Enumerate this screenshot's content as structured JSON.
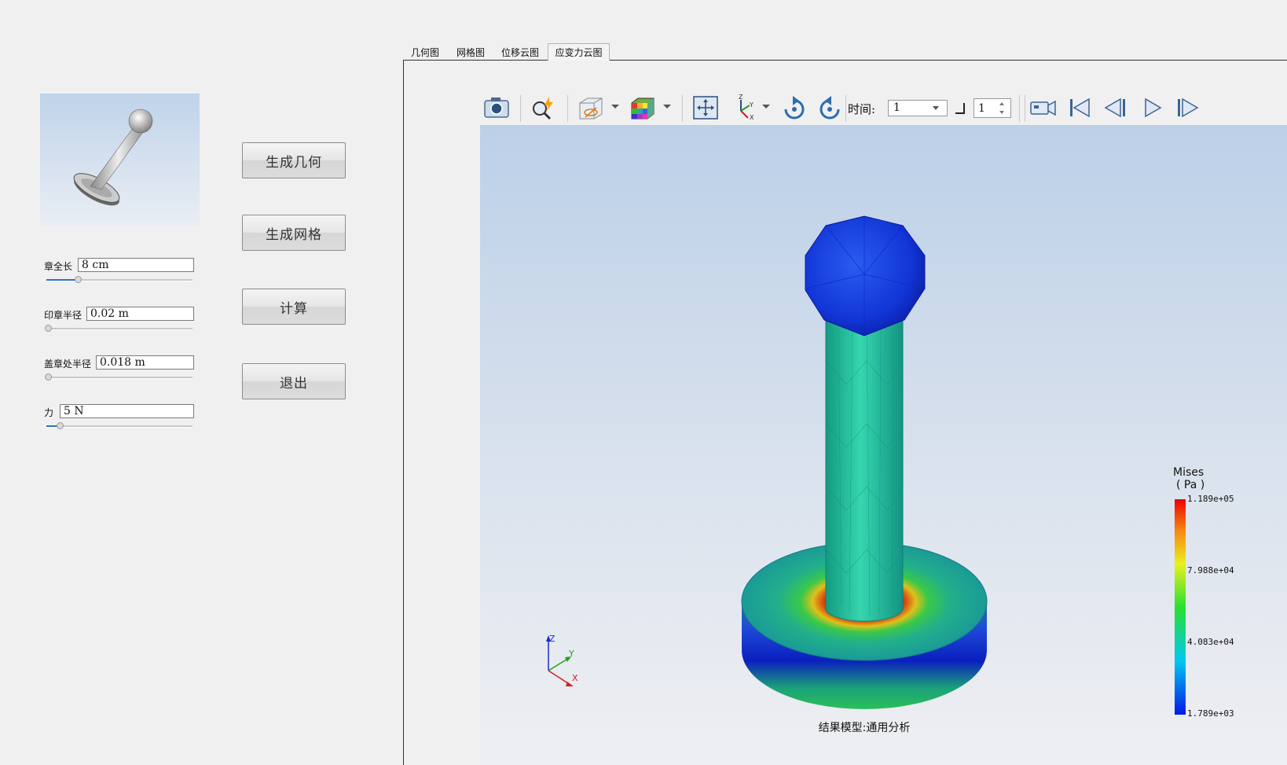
{
  "left_panel": {
    "params": [
      {
        "label": "章全长",
        "value": "8 cm",
        "slider_level": 0.22
      },
      {
        "label": "印章半径",
        "value": "0.02 m",
        "slider_level": 0.0
      },
      {
        "label": "盖章处半径",
        "value": "0.018 m",
        "slider_level": 0.0
      },
      {
        "label": "力",
        "value": "5 N",
        "slider_level": 0.09
      }
    ],
    "buttons": [
      "生成几何",
      "生成网格",
      "计算",
      "退出"
    ]
  },
  "tabs": {
    "items": [
      "几何图",
      "网格图",
      "位移云图",
      "应变力云图"
    ],
    "active": "应变力云图"
  },
  "toolbar": {
    "time_label": "时间:",
    "time_value": "1",
    "step_value": "1",
    "icons": [
      "camera-icon",
      "zoom-highlight-icon",
      "hide-element-icon",
      "color-cube-icon",
      "fit-view-icon",
      "axis-view-icon",
      "rotate-cw-icon",
      "rotate-ccw-icon",
      "record-video-icon",
      "first-frame-icon",
      "previous-frame-icon",
      "play-icon",
      "next-frame-icon"
    ]
  },
  "viewport": {
    "axes": {
      "z": "Z",
      "y": "Y",
      "x": "X"
    },
    "model_caption": "结果模型:通用分析",
    "legend": {
      "title": "Mises",
      "unit": "( Pa )",
      "ticks": [
        "1.189e+05",
        "7.988e+04",
        "4.083e+04",
        "1.789e+03"
      ]
    },
    "colors": {
      "low": "#0022ee",
      "mid": "#22dd22",
      "high": "#ff0000"
    }
  }
}
